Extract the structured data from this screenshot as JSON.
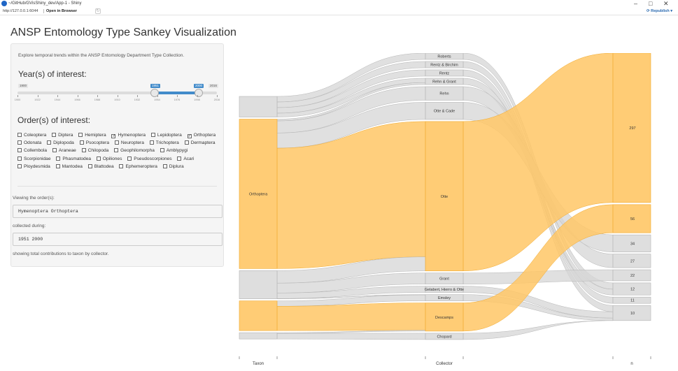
{
  "window": {
    "title": "~/GitHub/GVisShiny_dev/App-1 - Shiny",
    "minimize": "–",
    "maximize": "□",
    "close": "✕"
  },
  "toolbar": {
    "url": "http://127.0.0.1:6044",
    "open_in_browser": "Open in Browser",
    "republish": "Republish"
  },
  "page_title": "ANSP Entomology Type Sankey Visualization",
  "sidebar": {
    "intro": "Explore temporal trends within the ANSP Entomology Department Type Collection.",
    "years_label": "Year(s) of interest:",
    "slider": {
      "min": "1900",
      "max": "2016",
      "from": "1951",
      "to": "2000",
      "ticks": [
        "1900",
        "1922",
        "1944",
        "1966",
        "1988",
        "1910",
        "1932",
        "1954",
        "1976",
        "1998",
        "2016"
      ]
    },
    "orders_label": "Order(s) of interest:",
    "orders": [
      {
        "label": "Coleoptera",
        "checked": false
      },
      {
        "label": "Diptera",
        "checked": false
      },
      {
        "label": "Hemiptera",
        "checked": false
      },
      {
        "label": "Hymenoptera",
        "checked": true
      },
      {
        "label": "Lepidoptera",
        "checked": false
      },
      {
        "label": "Orthoptera",
        "checked": true
      },
      {
        "label": "Odonata",
        "checked": false
      },
      {
        "label": "Diplopoda",
        "checked": false
      },
      {
        "label": "Psocoptera",
        "checked": false
      },
      {
        "label": "Neuroptera",
        "checked": false
      },
      {
        "label": "Trichoptera",
        "checked": false
      },
      {
        "label": "Dermaptera",
        "checked": false
      },
      {
        "label": "Collembola",
        "checked": false
      },
      {
        "label": "Araneae",
        "checked": false
      },
      {
        "label": "Chilopoda",
        "checked": false
      },
      {
        "label": "Geophilomorpha",
        "checked": false
      },
      {
        "label": "Amblypygi",
        "checked": false
      },
      {
        "label": "Scorpionidae",
        "checked": false
      },
      {
        "label": "Phasmatodea",
        "checked": false
      },
      {
        "label": "Opiliones",
        "checked": false
      },
      {
        "label": "Pseudoscorpiones",
        "checked": false
      },
      {
        "label": "Acari",
        "checked": false
      },
      {
        "label": "Ploydesmida",
        "checked": false
      },
      {
        "label": "Mantodea",
        "checked": false
      },
      {
        "label": "Blattodea",
        "checked": false
      },
      {
        "label": "Ephemeroptera",
        "checked": false
      },
      {
        "label": "Diplura",
        "checked": false
      }
    ]
  },
  "output": {
    "viewing_label": "Viewing the order(s):",
    "viewing_value": "Hymenoptera Orthoptera",
    "collected_label": "collected during:",
    "collected_value": "1951 2000",
    "showing_label": "showing total contributions to taxon by collector."
  },
  "colors": {
    "highlight": "#ffc766",
    "highlight_border": "#f0a92c",
    "neutral": "#d6d6d6",
    "neutral_border": "#b5b5b5",
    "slider_blue": "#428bca"
  },
  "sankey": {
    "axis_labels": [
      "Taxon",
      "Collector",
      "n"
    ],
    "taxon_nodes": [
      {
        "label": "",
        "value": 41,
        "highlight": false
      },
      {
        "label": "Orthoptera",
        "value": 297,
        "highlight": true
      },
      {
        "label": "",
        "value": 56,
        "highlight": false
      },
      {
        "label": "",
        "value": 59,
        "highlight": true
      },
      {
        "label": "",
        "value": 10,
        "highlight": false
      }
    ],
    "collector_nodes": [
      {
        "label": "Roberts",
        "value": 12,
        "highlight": false
      },
      {
        "label": "Rentz & Birchim",
        "value": 11,
        "highlight": false
      },
      {
        "label": "Rentz",
        "value": 10,
        "highlight": false
      },
      {
        "label": "Rehn & Grant",
        "value": 12,
        "highlight": false
      },
      {
        "label": "Rehn",
        "value": 27,
        "highlight": false
      },
      {
        "label": "Otte & Cade",
        "value": 34,
        "highlight": false
      },
      {
        "label": "Otte",
        "value": 297,
        "highlight": true
      },
      {
        "label": "Grant",
        "value": 22,
        "highlight": false
      },
      {
        "label": "Gelabert, Hierro & Otte",
        "value": 10,
        "highlight": false
      },
      {
        "label": "Emsley",
        "value": 12,
        "highlight": false
      },
      {
        "label": "Descamps",
        "value": 56,
        "highlight": true
      },
      {
        "label": "Chopard",
        "value": 10,
        "highlight": false
      }
    ],
    "n_nodes": [
      {
        "label": "297",
        "value": 297,
        "highlight": true
      },
      {
        "label": "56",
        "value": 56,
        "highlight": true
      },
      {
        "label": "34",
        "value": 34,
        "highlight": false
      },
      {
        "label": "27",
        "value": 27,
        "highlight": false
      },
      {
        "label": "22",
        "value": 22,
        "highlight": false
      },
      {
        "label": "12",
        "value": 24,
        "highlight": false
      },
      {
        "label": "11",
        "value": 11,
        "highlight": false
      },
      {
        "label": "10",
        "value": 30,
        "highlight": false
      }
    ]
  }
}
